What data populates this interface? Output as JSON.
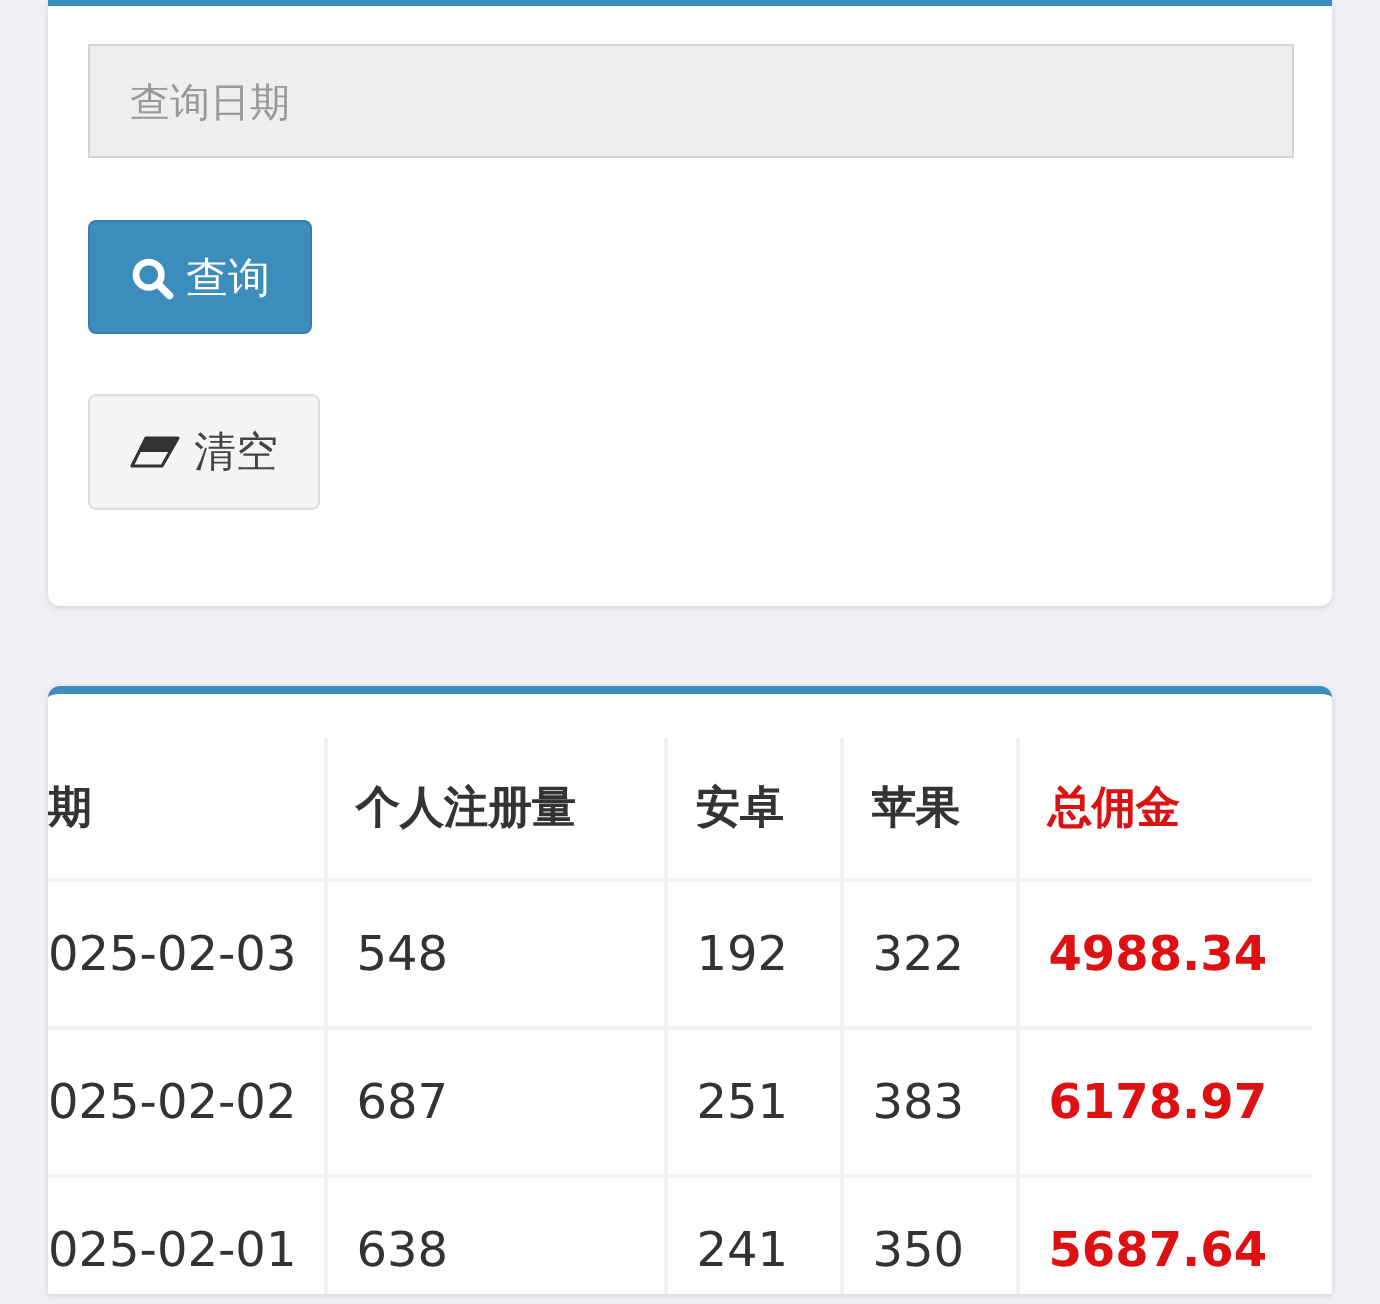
{
  "query_form": {
    "date_field": {
      "placeholder": "查询日期"
    },
    "buttons": [
      {
        "kind": "primary",
        "label": "查询"
      },
      {
        "kind": "default",
        "label": "清空"
      }
    ]
  },
  "table": {
    "columns": [
      {
        "label": "期",
        "highlight": false
      },
      {
        "label": "个人注册量",
        "highlight": false
      },
      {
        "label": "安卓",
        "highlight": false
      },
      {
        "label": "苹果",
        "highlight": false
      },
      {
        "label": "总佣金",
        "highlight": true
      }
    ],
    "rows": [
      [
        "025-02-03",
        "548",
        "192",
        "322",
        "4988.34"
      ],
      [
        "025-02-02",
        "687",
        "251",
        "383",
        "6178.97"
      ],
      [
        "025-02-01",
        "638",
        "241",
        "350",
        "5687.64"
      ]
    ]
  }
}
